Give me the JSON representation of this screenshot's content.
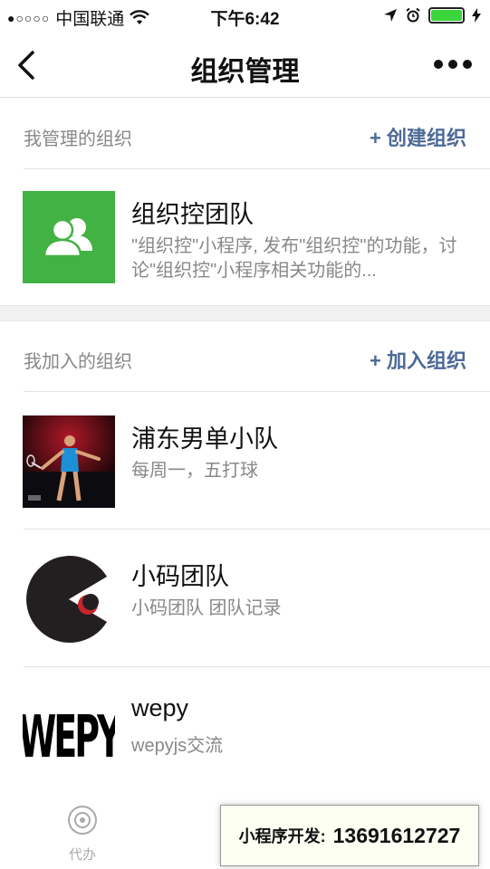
{
  "status_bar": {
    "signal_dots": "●○○○○",
    "carrier": "中国联通",
    "time": "下午6:42"
  },
  "nav": {
    "title": "组织管理"
  },
  "managed": {
    "label": "我管理的组织",
    "action": "+ 创建组织",
    "items": [
      {
        "name": "组织控团队",
        "desc": "\"组织控\"小程序, 发布\"组织控\"的功能，讨论\"组织控\"小程序相关功能的...",
        "thumb_color": "#43b244"
      }
    ]
  },
  "joined": {
    "label": "我加入的组织",
    "action": "+ 加入组织",
    "items": [
      {
        "name": "浦东男单小队",
        "desc": "每周一，五打球"
      },
      {
        "name": "小码团队",
        "desc": "小码团队 团队记录"
      },
      {
        "name": "wepy",
        "desc": "wepyjs交流",
        "logo_text": "WEPY"
      }
    ]
  },
  "tabbar": {
    "tab1_label": "代办"
  },
  "promo": {
    "label": "小程序开发:",
    "phone": "13691612727"
  },
  "colors": {
    "accent_link": "#4d6a96",
    "battery": "#3bd43b",
    "team_green": "#43b244"
  }
}
